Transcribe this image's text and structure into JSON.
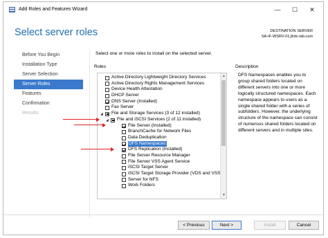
{
  "window": {
    "title": "Add Roles and Features Wizard",
    "controls": [
      "minimize",
      "maximize",
      "close"
    ]
  },
  "header": {
    "page_title": "Select server roles",
    "destination_label": "DESTINATION SERVER",
    "destination_server": "SA-IF-WSRV-01.jfrdc-lab.com"
  },
  "nav": {
    "items": [
      {
        "label": "Before You Begin",
        "state": "normal"
      },
      {
        "label": "Installation Type",
        "state": "normal"
      },
      {
        "label": "Server Selection",
        "state": "normal"
      },
      {
        "label": "Server Roles",
        "state": "active"
      },
      {
        "label": "Features",
        "state": "normal"
      },
      {
        "label": "Confirmation",
        "state": "normal"
      },
      {
        "label": "Results",
        "state": "disabled"
      }
    ]
  },
  "main": {
    "instruction": "Select one or more roles to install on the selected server.",
    "roles_header": "Roles",
    "description_header": "Description",
    "description": "DFS Namespaces enables you to group shared folders located on different servers into one or more logically structured namespaces. Each namespace appears to users as a single shared folder with a series of subfolders. However, the underlying structure of the namespace can consist of numerous shared folders located on different servers and in multiple sites."
  },
  "roles": [
    {
      "label": "Active Directory Lightweight Directory Services",
      "level": 0,
      "check": "unchecked",
      "expander": ""
    },
    {
      "label": "Active Directory Rights Management Services",
      "level": 0,
      "check": "unchecked",
      "expander": ""
    },
    {
      "label": "Device Health Attestation",
      "level": 0,
      "check": "unchecked",
      "expander": ""
    },
    {
      "label": "DHCP Server",
      "level": 0,
      "check": "unchecked",
      "expander": ""
    },
    {
      "label": "DNS Server (Installed)",
      "level": 0,
      "check": "checked",
      "expander": ""
    },
    {
      "label": "Fax Server",
      "level": 0,
      "check": "unchecked",
      "expander": ""
    },
    {
      "label": "File and Storage Services (3 of 12 installed)",
      "level": 0,
      "check": "partial",
      "expander": "◢"
    },
    {
      "label": "File and iSCSI Services (2 of 11 installed)",
      "level": 1,
      "check": "partial",
      "expander": "◢"
    },
    {
      "label": "File Server (Installed)",
      "level": 2,
      "check": "checked",
      "expander": ""
    },
    {
      "label": "BranchCache for Network Files",
      "level": 2,
      "check": "unchecked",
      "expander": ""
    },
    {
      "label": "Data Deduplication",
      "level": 2,
      "check": "unchecked",
      "expander": ""
    },
    {
      "label": "DFS Namespaces",
      "level": 2,
      "check": "checked",
      "expander": "",
      "selected": true
    },
    {
      "label": "DFS Replication (Installed)",
      "level": 2,
      "check": "checked",
      "expander": ""
    },
    {
      "label": "File Server Resource Manager",
      "level": 2,
      "check": "unchecked",
      "expander": ""
    },
    {
      "label": "File Server VSS Agent Service",
      "level": 2,
      "check": "unchecked",
      "expander": ""
    },
    {
      "label": "iSCSI Target Server",
      "level": 2,
      "check": "unchecked",
      "expander": ""
    },
    {
      "label": "iSCSI Target Storage Provider (VDS and VSS",
      "level": 2,
      "check": "unchecked",
      "expander": ""
    },
    {
      "label": "Server for NFS",
      "level": 2,
      "check": "unchecked",
      "expander": ""
    },
    {
      "label": "Work Folders",
      "level": 2,
      "check": "unchecked",
      "expander": ""
    }
  ],
  "buttons": {
    "previous": "< Previous",
    "next": "Next >",
    "install": "Install",
    "cancel": "Cancel"
  },
  "colors": {
    "accent": "#3a79cc",
    "title_blue": "#1f6fb2",
    "annotation_arrow": "#e02020"
  }
}
